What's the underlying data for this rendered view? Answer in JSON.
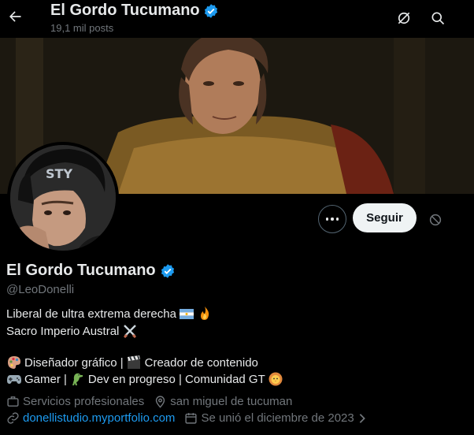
{
  "header": {
    "title": "El Gordo Tucumano",
    "posts_count": "19,1 mil posts"
  },
  "actions": {
    "follow_label": "Seguir"
  },
  "profile": {
    "name": "El Gordo Tucumano",
    "handle": "@LeoDonelli",
    "bio": {
      "line1": "Liberal de ultra extrema derecha",
      "line2": "Sacro Imperio Austral",
      "line3a": "Diseñador gráfico |",
      "line3b": "Creador de contenido",
      "line4a": "Gamer |",
      "line4b": "Dev en progreso | Comunidad GT"
    },
    "category": "Servicios profesionales",
    "location": "san miguel de tucuman",
    "website": "donellistudio.myportfolio.com",
    "joined": "Se unió el diciembre de 2023"
  },
  "colors": {
    "verified": "#1d9bf0",
    "link": "#1d9bf0",
    "muted": "#71767b",
    "text": "#e7e9ea"
  },
  "icons": [
    "back-arrow-icon",
    "verified-badge-icon",
    "grok-icon",
    "search-icon",
    "more-icon",
    "block-icon",
    "briefcase-icon",
    "location-pin-icon",
    "link-icon",
    "calendar-icon",
    "chevron-right-icon"
  ]
}
